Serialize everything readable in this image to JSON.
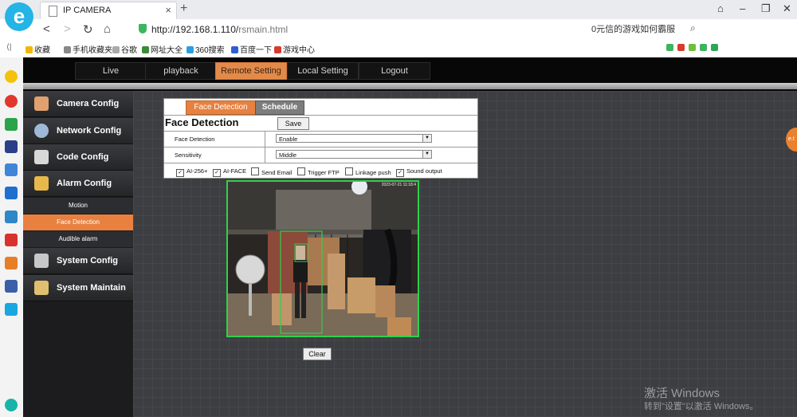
{
  "browser": {
    "tab_title": "IP CAMERA",
    "tab_close": "×",
    "new_tab": "+",
    "url_host": "http://192.168.1.110/",
    "url_path": "rsmain.html",
    "search_text": "0元信的游戏如何霸服",
    "logo_letter": "e",
    "bookmarks": [
      "收藏",
      "手机收藏夹",
      "谷歌",
      "网址大全",
      "360搜索",
      "百度一下",
      "游戏中心"
    ],
    "back_glyph": "<",
    "forward_glyph": ">",
    "reload_glyph": "↻",
    "home_glyph": "⌂",
    "collapse_glyph": "⟨|",
    "win_min": "–",
    "win_max": "❐",
    "win_close": "✕"
  },
  "colors": {
    "accent": "#e8813f",
    "frame_green": "#31d04a"
  },
  "main_tabs": [
    {
      "label": "Live",
      "active": false
    },
    {
      "label": "playback",
      "active": false
    },
    {
      "label": "Remote Setting",
      "active": true
    },
    {
      "label": "Local Setting",
      "active": false
    },
    {
      "label": "Logout",
      "active": false
    }
  ],
  "sidebar": {
    "items": [
      {
        "label": "Camera Config",
        "icon": "monitor-icon"
      },
      {
        "label": "Network Config",
        "icon": "globe-icon"
      },
      {
        "label": "Code Config",
        "icon": "film-icon"
      },
      {
        "label": "Alarm Config",
        "icon": "bell-icon"
      },
      {
        "label": "System Config",
        "icon": "gear-icon"
      },
      {
        "label": "System Maintain",
        "icon": "tools-icon"
      }
    ],
    "alarm_subitems": [
      {
        "label": "Motion",
        "active": false
      },
      {
        "label": "Face Detection",
        "active": true
      },
      {
        "label": "Audible alarm",
        "active": false
      }
    ]
  },
  "panel": {
    "tabs": [
      "Face Detection",
      "Schedule"
    ],
    "title": "Face Detection",
    "save_label": "Save",
    "fields": [
      {
        "label": "Face Detection",
        "value": "Enable"
      },
      {
        "label": "Sensitivity",
        "value": "Middle"
      }
    ],
    "checkboxes": [
      {
        "label": "AI-256+",
        "checked": true
      },
      {
        "label": "AI-FACE",
        "checked": true
      },
      {
        "label": "Send Email",
        "checked": false
      },
      {
        "label": "Trigger FTP",
        "checked": false
      },
      {
        "label": "Linkage push",
        "checked": false
      },
      {
        "label": "Sound output",
        "checked": true
      }
    ],
    "check_mark": "✓",
    "dropdown_arrow": "▼"
  },
  "video": {
    "timestamp": "2023-07-21 11:18:4"
  },
  "clear_label": "Clear",
  "watermark": {
    "line1": "激活 Windows",
    "line2": "转到\"设置\"以激活 Windows。"
  },
  "edge_badge": "e.t"
}
